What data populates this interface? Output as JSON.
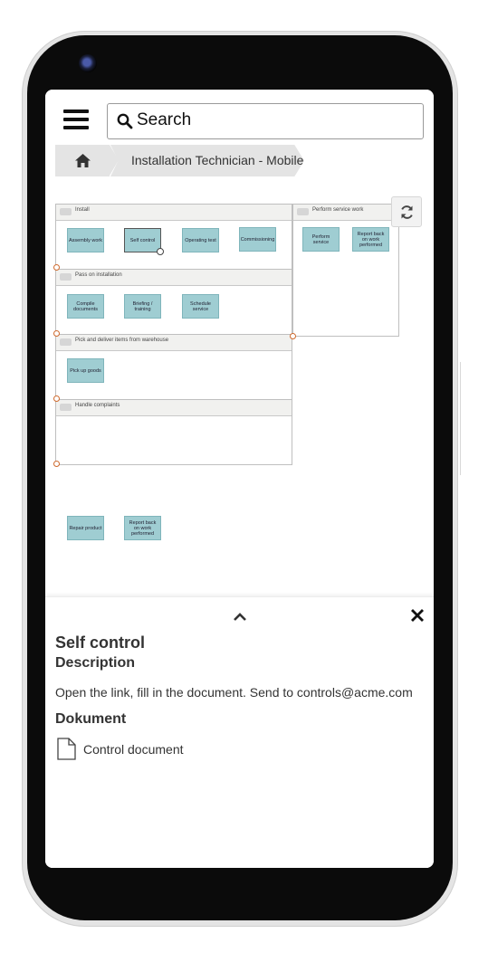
{
  "search": {
    "placeholder": "Search"
  },
  "breadcrumb": {
    "current": "Installation Technician - Mobile"
  },
  "diagram": {
    "lanes": {
      "install": "Install",
      "pass": "Pass on installation",
      "pick": "Pick and deliver items from warehouse",
      "complaints": "Handle complaints",
      "service": "Perform service work"
    },
    "tasks": {
      "assembly": "Assembly work",
      "self_control": "Self control",
      "operating_test": "Operating test",
      "commissioning": "Commissioning",
      "compile": "Compile documents",
      "briefing": "Briefing / training",
      "schedule": "Schedule service",
      "pickup": "Pick up goods",
      "repair": "Repair product",
      "report1": "Report back on work performed",
      "perform_service": "Perform service",
      "report2": "Report back on work performed"
    }
  },
  "panel": {
    "title": "Self control",
    "description_heading": "Description",
    "description": "Open the link, fill in the document. Send to controls@acme.com",
    "document_heading": "Dokument",
    "document_link": "Control document"
  }
}
